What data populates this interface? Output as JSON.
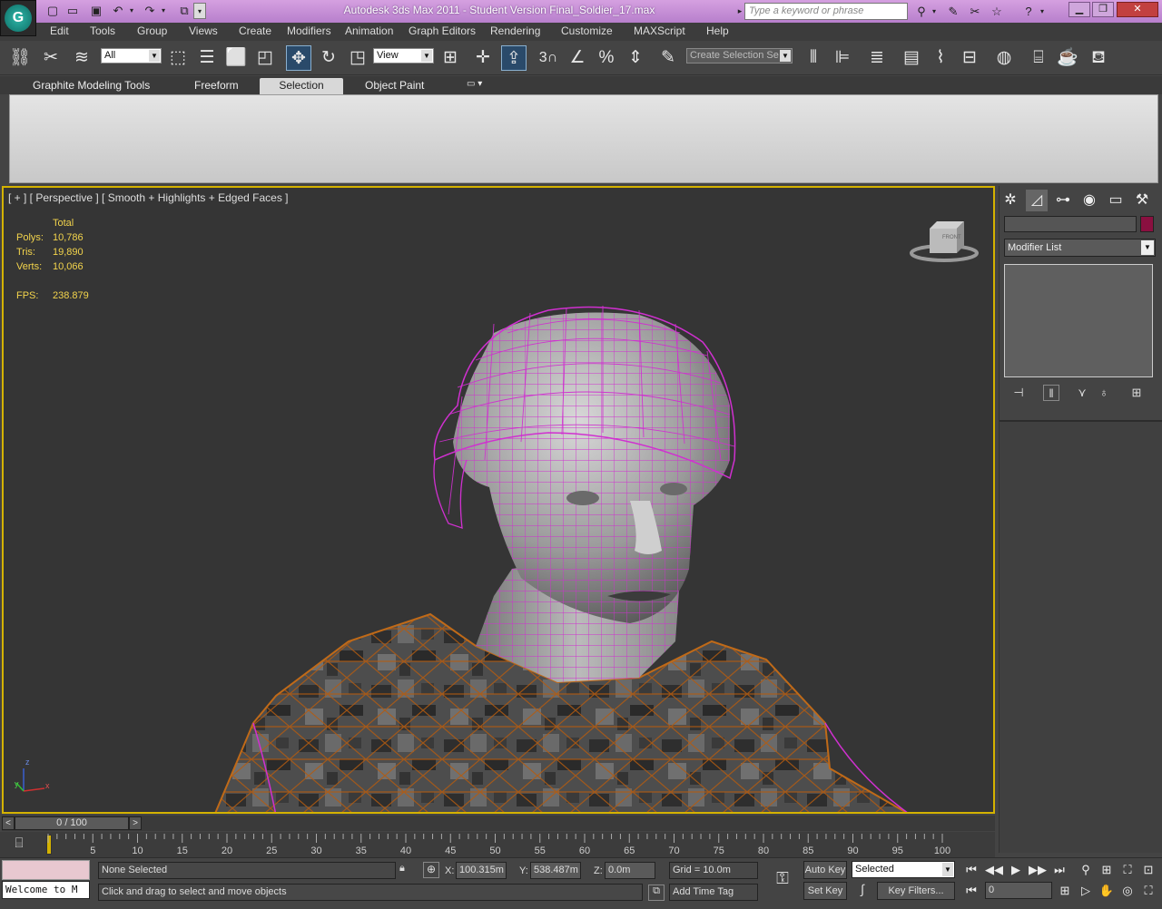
{
  "window": {
    "title": "Autodesk 3ds Max  2011   - Student Version    Final_Soldier_17.max",
    "search_placeholder": "Type a keyword or phrase"
  },
  "menu": [
    "Edit",
    "Tools",
    "Group",
    "Views",
    "Create",
    "Modifiers",
    "Animation",
    "Graph Editors",
    "Rendering",
    "Customize",
    "MAXScript",
    "Help"
  ],
  "toolbar": {
    "selection_filter": "All",
    "reference_coord": "View",
    "named_selection_placeholder": "Create Selection Se",
    "snap_label": "3"
  },
  "ribbon": {
    "tabs": [
      "Graphite Modeling Tools",
      "Freeform",
      "Selection",
      "Object Paint"
    ],
    "active_tab": "Selection"
  },
  "viewport": {
    "label": "[ + ] [ Perspective ] [ Smooth + Highlights + Edged Faces ]",
    "stats": {
      "header": "Total",
      "polys_label": "Polys:",
      "polys": "10,786",
      "tris_label": "Tris:",
      "tris": "19,890",
      "verts_label": "Verts:",
      "verts": "10,066",
      "fps_label": "FPS:",
      "fps": "238.879"
    },
    "viewcube_face": "FRONT",
    "axis": {
      "z": "z",
      "y": "y",
      "x": "x"
    }
  },
  "command_panel": {
    "modifier_list": "Modifier List"
  },
  "time_slider": {
    "value": "0 / 100",
    "prev": "<",
    "next": ">"
  },
  "trackbar": {
    "ticks": [
      "5",
      "10",
      "15",
      "20",
      "25",
      "30",
      "35",
      "40",
      "45",
      "50",
      "55",
      "60",
      "65",
      "70",
      "75",
      "80",
      "85",
      "90",
      "95",
      "100"
    ]
  },
  "status": {
    "listener_text": "Welcome to M",
    "selection": "None Selected",
    "prompt": "Click and drag to select and move objects",
    "x_label": "X:",
    "x": "100.315m",
    "y_label": "Y:",
    "y": "538.487m",
    "z_label": "Z:",
    "z": "0.0m",
    "grid": "Grid = 10.0m",
    "add_time_tag": "Add Time Tag",
    "auto_key": "Auto Key",
    "set_key": "Set Key",
    "key_mode": "Selected",
    "key_filters": "Key Filters...",
    "frame": "0"
  },
  "colors": {
    "title_bar": "#c691d6",
    "viewport_border": "#d4b200",
    "stats_text": "#f3d44c",
    "wireframe": "#d030d0",
    "object_color": "#8a1040"
  }
}
